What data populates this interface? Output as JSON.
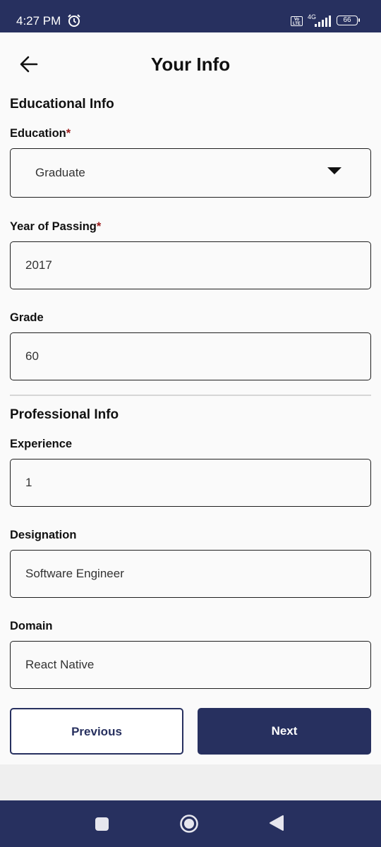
{
  "status_bar": {
    "time": "4:27 PM",
    "volte": "Vo LTE",
    "network": "4G",
    "battery": "66"
  },
  "header": {
    "title": "Your Info"
  },
  "educational": {
    "heading": "Educational Info",
    "education_label": "Education",
    "education_value": "Graduate",
    "year_label": "Year of Passing",
    "year_value": "2017",
    "grade_label": "Grade",
    "grade_value": "60"
  },
  "professional": {
    "heading": "Professional Info",
    "experience_label": "Experience",
    "experience_value": "1",
    "designation_label": "Designation",
    "designation_value": "Software Engineer",
    "domain_label": "Domain",
    "domain_value": "React Native"
  },
  "required_mark": "*",
  "buttons": {
    "previous": "Previous",
    "next": "Next"
  },
  "colors": {
    "brand": "#27305f",
    "required": "#9b1b1b"
  },
  "icons": {
    "back": "arrow-left",
    "alarm": "alarm-clock",
    "dropdown": "caret-down",
    "nav_recents": "square",
    "nav_home": "circle",
    "nav_back": "triangle-left"
  }
}
